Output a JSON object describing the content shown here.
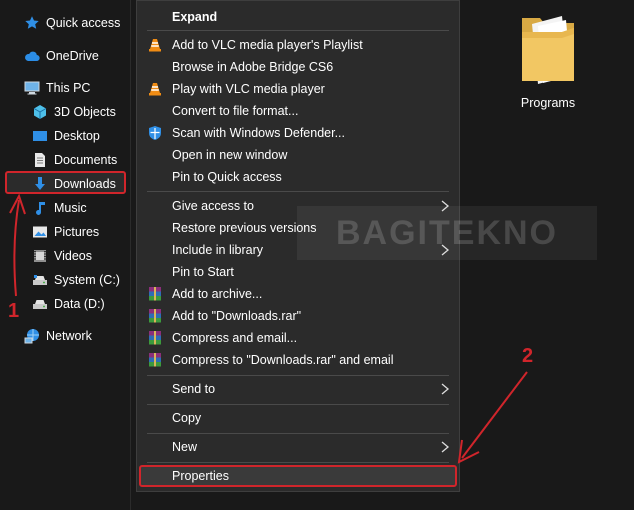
{
  "sidebar": {
    "items": [
      {
        "label": "Quick access",
        "icon": "star-icon"
      },
      {
        "label": "OneDrive",
        "icon": "cloud-icon"
      },
      {
        "label": "This PC",
        "icon": "computer-icon"
      },
      {
        "label": "3D Objects",
        "icon": "cube-icon"
      },
      {
        "label": "Desktop",
        "icon": "desktop-icon"
      },
      {
        "label": "Documents",
        "icon": "document-icon"
      },
      {
        "label": "Downloads",
        "icon": "download-arrow-icon"
      },
      {
        "label": "Music",
        "icon": "music-note-icon"
      },
      {
        "label": "Pictures",
        "icon": "picture-icon"
      },
      {
        "label": "Videos",
        "icon": "film-icon"
      },
      {
        "label": "System (C:)",
        "icon": "drive-icon"
      },
      {
        "label": "Data (D:)",
        "icon": "drive-icon"
      },
      {
        "label": "Network",
        "icon": "network-icon"
      }
    ]
  },
  "content": {
    "folder_label": "Programs"
  },
  "context_menu": {
    "items": [
      {
        "label": "Expand",
        "bold": true,
        "icon": null,
        "submenu": false
      },
      {
        "label": "Add to VLC media player's Playlist",
        "icon": "vlc-cone-icon",
        "submenu": false
      },
      {
        "label": "Browse in Adobe Bridge CS6",
        "icon": null,
        "submenu": false
      },
      {
        "label": "Play with VLC media player",
        "icon": "vlc-cone-icon",
        "submenu": false
      },
      {
        "label": "Convert to file format...",
        "icon": null,
        "submenu": false
      },
      {
        "label": "Scan with Windows Defender...",
        "icon": "windows-defender-icon",
        "submenu": false
      },
      {
        "label": "Open in new window",
        "icon": null,
        "submenu": false
      },
      {
        "label": "Pin to Quick access",
        "icon": null,
        "submenu": false
      },
      {
        "label": "Give access to",
        "icon": null,
        "submenu": true
      },
      {
        "label": "Restore previous versions",
        "icon": null,
        "submenu": false
      },
      {
        "label": "Include in library",
        "icon": null,
        "submenu": true
      },
      {
        "label": "Pin to Start",
        "icon": null,
        "submenu": false
      },
      {
        "label": "Add to archive...",
        "icon": "winrar-icon",
        "submenu": false
      },
      {
        "label": "Add to \"Downloads.rar\"",
        "icon": "winrar-icon",
        "submenu": false
      },
      {
        "label": "Compress and email...",
        "icon": "winrar-icon",
        "submenu": false
      },
      {
        "label": "Compress to \"Downloads.rar\" and email",
        "icon": "winrar-icon",
        "submenu": false
      },
      {
        "label": "Send to",
        "icon": null,
        "submenu": true
      },
      {
        "label": "Copy",
        "icon": null,
        "submenu": false
      },
      {
        "label": "New",
        "icon": null,
        "submenu": true
      },
      {
        "label": "Properties",
        "icon": null,
        "submenu": false
      }
    ]
  },
  "annotations": {
    "step1": "1",
    "step2": "2",
    "color": "#d0252b"
  },
  "watermark": "BAGITEKNO"
}
